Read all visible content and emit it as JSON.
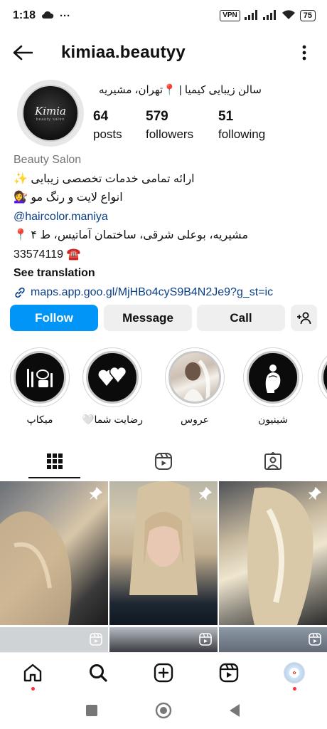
{
  "status_bar": {
    "time": "1:18",
    "dots": "···",
    "vpn": "VPN",
    "battery": "75"
  },
  "header": {
    "username": "kimiaa.beautyy"
  },
  "profile": {
    "full_name": "سالن زیبایی کیمیا | 📍تهران، مشیریه",
    "avatar_brand": "Kimia",
    "avatar_sub": "beauty salon",
    "stats": {
      "posts_count": "64",
      "posts_label": "posts",
      "followers_count": "579",
      "followers_label": "followers",
      "following_count": "51",
      "following_label": "following"
    },
    "bio": {
      "category": "Beauty Salon",
      "line1": "ارائه تمامی خدمات تخصصی زیبایی ✨",
      "line2": "انواع لایت و رنگ مو 💇‍♀️",
      "mention": "@haircolor.maniya",
      "line4": "مشیریه، بوعلی شرقی، ساختمان آماتیس، ط ۴ 📍",
      "phone": "33574119 ☎️",
      "see_translation": "See translation",
      "link": "maps.app.goo.gl/MjHBo4cyS9B4N2Je9?g_st=ic"
    }
  },
  "actions": {
    "follow": "Follow",
    "message": "Message",
    "call": "Call"
  },
  "highlights": [
    {
      "label": "میکاپ",
      "icon": "makeup-icon"
    },
    {
      "label": "رضایت شما🤍",
      "icon": "hearts-icon"
    },
    {
      "label": "عروس",
      "icon": "bride-photo"
    },
    {
      "label": "شینیون",
      "icon": "hair-bun-icon"
    }
  ],
  "tabs": [
    "grid-icon",
    "reels-icon",
    "tagged-icon"
  ],
  "colors": {
    "follow_blue": "#0095f6",
    "link_blue": "#0a3f86",
    "notification_red": "#ff3040"
  }
}
